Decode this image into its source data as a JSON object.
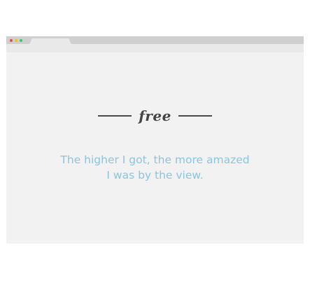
{
  "window": {
    "tab_label": ""
  },
  "colors": {
    "accent_text": "#8cc4df",
    "brand_text": "#444444",
    "window_bg": "#f2f2f2",
    "traffic_red": "#e74c3c",
    "traffic_yellow": "#f1c40f",
    "traffic_green": "#2ecc71"
  },
  "hero": {
    "brand": "free",
    "quote_line_1": "The higher I got, the more amazed",
    "quote_line_2": "I was by the view."
  }
}
